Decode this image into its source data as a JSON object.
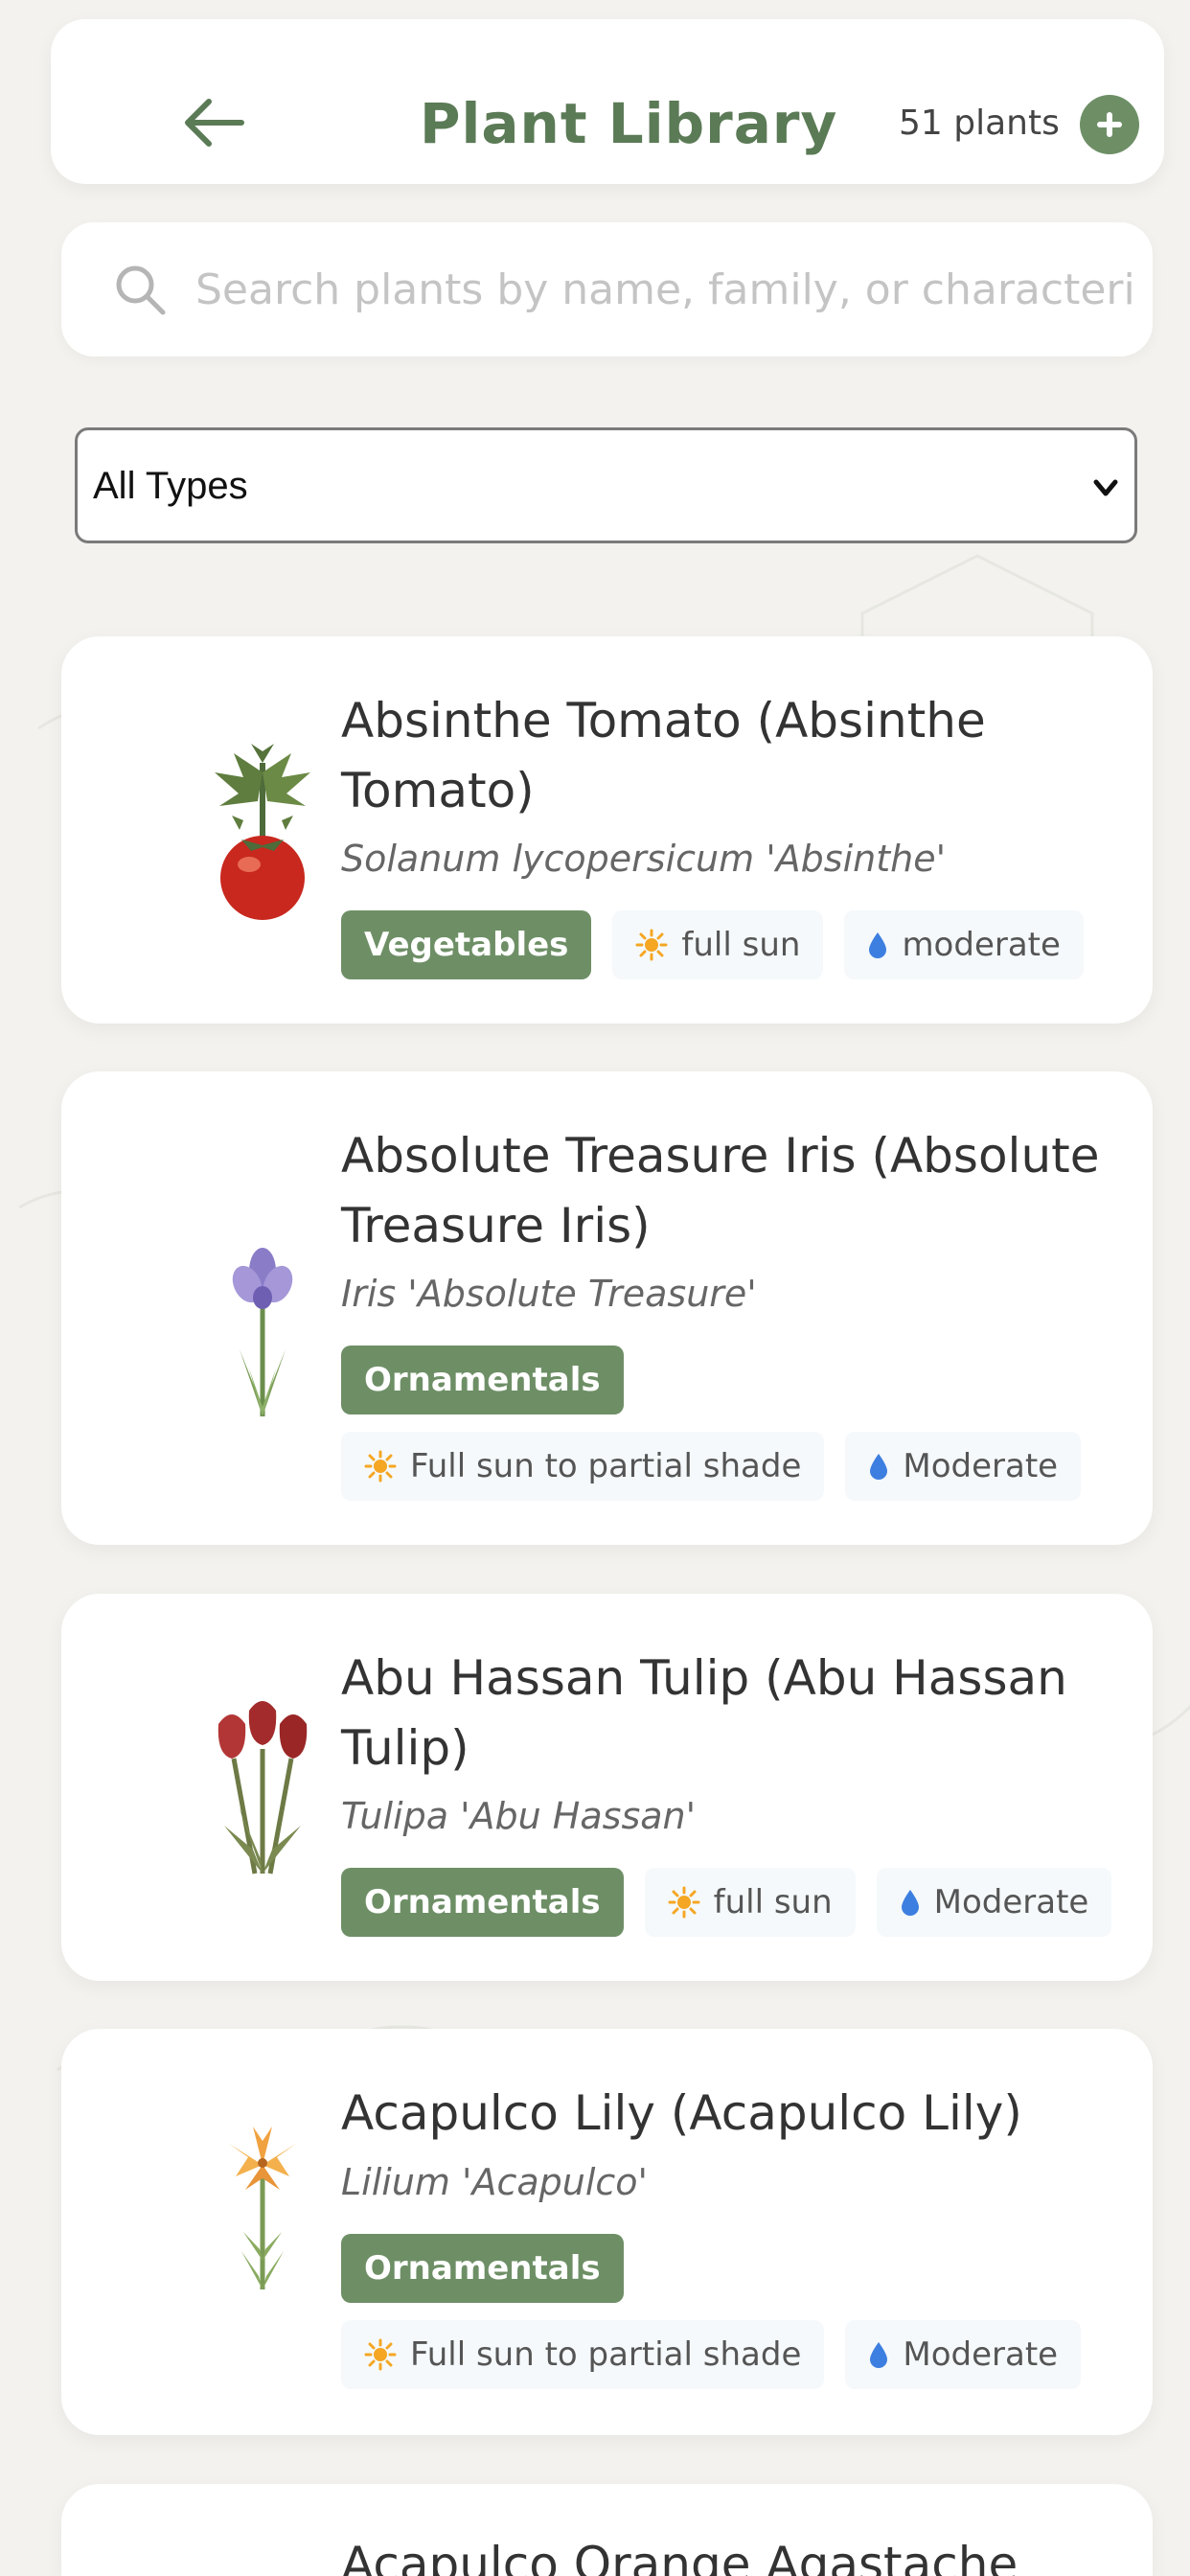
{
  "header": {
    "title": "Plant Library",
    "count_label": "51 plants"
  },
  "search": {
    "placeholder": "Search plants by name, family, or characteris"
  },
  "filter": {
    "selected": "All Types"
  },
  "plants": [
    {
      "name": "Absinthe Tomato (Absinthe Tomato)",
      "scientific": "Solanum lycopersicum 'Absinthe'",
      "category": "Vegetables",
      "sun": "full sun",
      "water": "moderate",
      "icon": "tomato-plant-icon"
    },
    {
      "name": "Absolute Treasure Iris (Absolute Treasure Iris)",
      "scientific": "Iris 'Absolute Treasure'",
      "category": "Ornamentals",
      "sun": "Full sun to partial shade",
      "water": "Moderate",
      "icon": "iris-flower-icon"
    },
    {
      "name": "Abu Hassan Tulip (Abu Hassan Tulip)",
      "scientific": "Tulipa 'Abu Hassan'",
      "category": "Ornamentals",
      "sun": "full sun",
      "water": "Moderate",
      "icon": "tulip-flower-icon"
    },
    {
      "name": "Acapulco Lily (Acapulco Lily)",
      "scientific": "Lilium 'Acapulco'",
      "category": "Ornamentals",
      "sun": "Full sun to partial shade",
      "water": "Moderate",
      "icon": "lily-flower-icon"
    },
    {
      "name": "Acapulco Orange Agastache"
    }
  ],
  "colors": {
    "accent": "#6e8f66",
    "title": "#5b7a56",
    "sun": "#f5a623",
    "water": "#3d7fe0",
    "background": "#f3f2ee"
  }
}
